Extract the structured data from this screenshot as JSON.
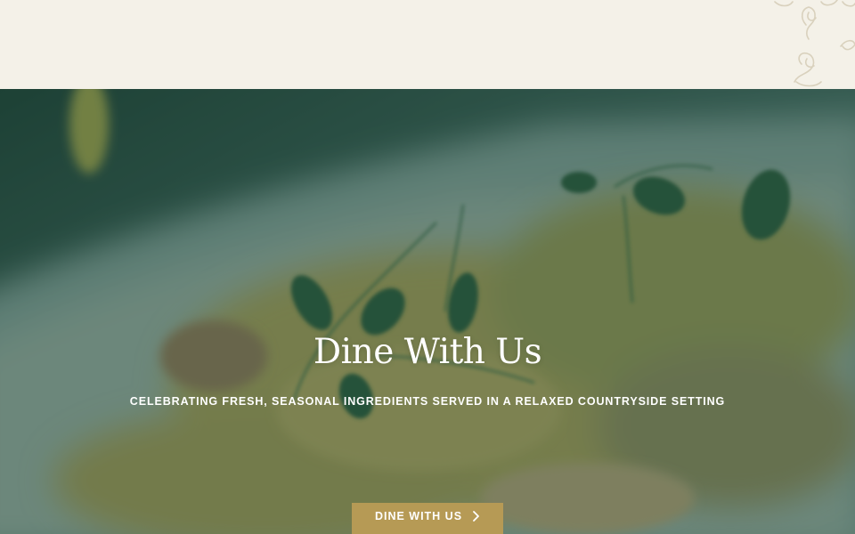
{
  "hero": {
    "title": "Dine With Us",
    "subtitle": "CELEBRATING FRESH, SEASONAL INGREDIENTS SERVED IN A RELAXED COUNTRYSIDE SETTING",
    "cta_label": "DINE WITH US"
  },
  "icons": {
    "ornament": "celtic-knot-icon",
    "cta_arrow": "chevron-right-icon"
  },
  "colors": {
    "top_band": "#f4f1e8",
    "overlay": "#1b483a",
    "cta_background": "#b69a55",
    "text": "#ffffff"
  }
}
